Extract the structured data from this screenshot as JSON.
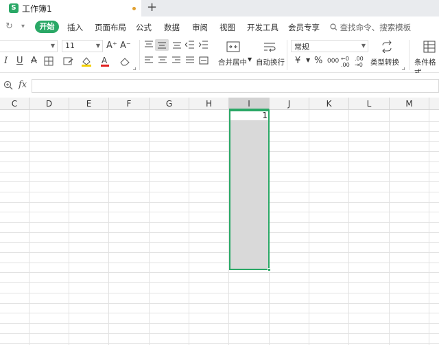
{
  "titlebar": {
    "logo": "S",
    "doc_title": "工作簿1",
    "add_tab": "+"
  },
  "menu": {
    "redo_icon": "↻",
    "more_icon": "▾",
    "start": "开始",
    "items": [
      "插入",
      "页面布局",
      "公式",
      "数据",
      "审阅",
      "视图",
      "开发工具",
      "会员专享"
    ],
    "search": "查找命令、搜索模板"
  },
  "toolbar": {
    "font_size": "11",
    "grow_font": "A⁺",
    "shrink_font": "A⁻",
    "italic": "I",
    "underline": "U",
    "strike": "A",
    "merge_label": "合并居中",
    "wrap_label": "自动换行",
    "format_value": "常规",
    "currency": "¥",
    "percent": "%",
    "thousands": "000",
    "dec_add": "←0 .00",
    "dec_remove": ".00 →0",
    "convert_label": "类型转换",
    "cond_format_label": "条件格式"
  },
  "formula_bar": {
    "fx": "fx",
    "value": ""
  },
  "grid": {
    "columns": [
      "C",
      "D",
      "E",
      "F",
      "G",
      "H",
      "I",
      "J",
      "K",
      "L",
      "M"
    ],
    "selected_column": "I",
    "active_cell_value": "1"
  },
  "colors": {
    "accent": "#2aa866",
    "selection_fill": "#d9d9d9"
  }
}
